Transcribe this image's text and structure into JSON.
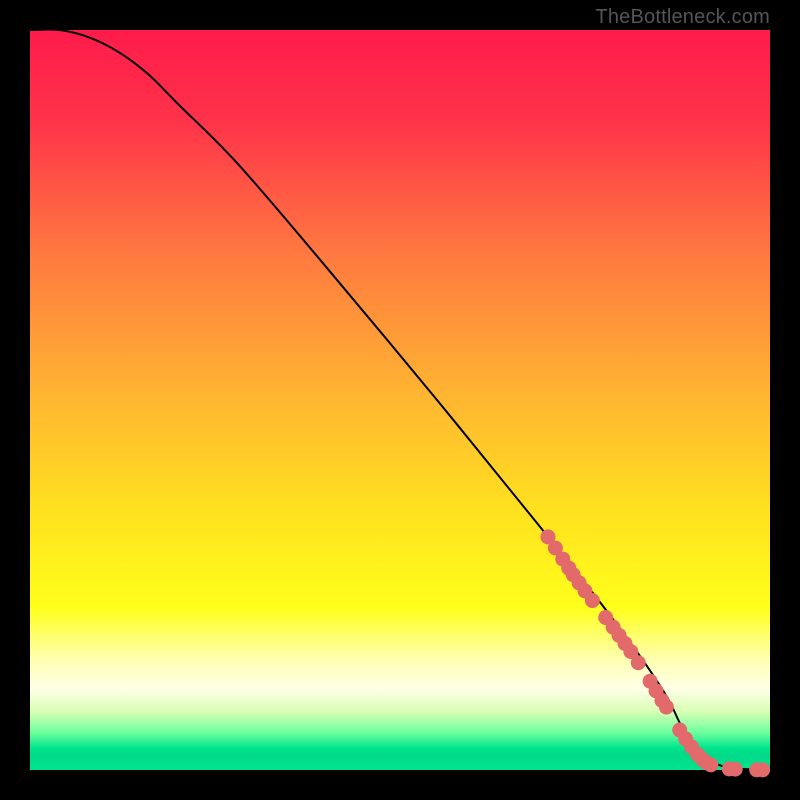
{
  "attribution": "TheBottleneck.com",
  "colors": {
    "frame": "#000000",
    "line": "#000000",
    "point_fill": "#e26a6a",
    "point_stroke": "#d85a5a",
    "attribution_text": "#555559"
  },
  "gradient_stops": [
    {
      "pct": 0,
      "color": "#ff1b4b"
    },
    {
      "pct": 12,
      "color": "#ff324a"
    },
    {
      "pct": 30,
      "color": "#ff7840"
    },
    {
      "pct": 50,
      "color": "#ffb731"
    },
    {
      "pct": 65,
      "color": "#ffe11f"
    },
    {
      "pct": 78,
      "color": "#ffff1b"
    },
    {
      "pct": 85,
      "color": "#ffffb0"
    },
    {
      "pct": 89,
      "color": "#ffffe8"
    },
    {
      "pct": 92,
      "color": "#d9ffb5"
    },
    {
      "pct": 95,
      "color": "#6bff9e"
    },
    {
      "pct": 97,
      "color": "#00e58e"
    },
    {
      "pct": 98,
      "color": "#00d989"
    },
    {
      "pct": 100,
      "color": "#00e58e"
    }
  ],
  "chart_data": {
    "type": "line",
    "title": "",
    "xlabel": "",
    "ylabel": "",
    "xlim": [
      0,
      100
    ],
    "ylim": [
      0,
      100
    ],
    "series": [
      {
        "name": "curve",
        "x": [
          0,
          4,
          8,
          12,
          16,
          20,
          28,
          40,
          55,
          68,
          76,
          82,
          86,
          88,
          90,
          92,
          94,
          96,
          98,
          100
        ],
        "y": [
          100,
          100,
          99,
          97,
          94,
          90,
          82,
          68,
          50,
          34,
          24,
          16,
          10,
          6,
          3,
          1.2,
          0.4,
          0.15,
          0.05,
          0
        ]
      }
    ],
    "points": [
      {
        "x": 70.0,
        "y": 31.5
      },
      {
        "x": 71.0,
        "y": 30.0
      },
      {
        "x": 72.0,
        "y": 28.5
      },
      {
        "x": 72.8,
        "y": 27.3
      },
      {
        "x": 73.4,
        "y": 26.4
      },
      {
        "x": 74.2,
        "y": 25.3
      },
      {
        "x": 75.0,
        "y": 24.2
      },
      {
        "x": 76.0,
        "y": 22.9
      },
      {
        "x": 77.8,
        "y": 20.6
      },
      {
        "x": 78.8,
        "y": 19.3
      },
      {
        "x": 79.6,
        "y": 18.2
      },
      {
        "x": 80.4,
        "y": 17.1
      },
      {
        "x": 81.2,
        "y": 16.0
      },
      {
        "x": 82.2,
        "y": 14.5
      },
      {
        "x": 83.8,
        "y": 12.0
      },
      {
        "x": 84.6,
        "y": 10.7
      },
      {
        "x": 85.4,
        "y": 9.4
      },
      {
        "x": 86.0,
        "y": 8.5
      },
      {
        "x": 87.8,
        "y": 5.4
      },
      {
        "x": 88.6,
        "y": 4.2
      },
      {
        "x": 89.4,
        "y": 3.1
      },
      {
        "x": 90.2,
        "y": 2.1
      },
      {
        "x": 90.8,
        "y": 1.5
      },
      {
        "x": 91.4,
        "y": 1.0
      },
      {
        "x": 92.0,
        "y": 0.7
      },
      {
        "x": 94.5,
        "y": 0.15
      },
      {
        "x": 95.3,
        "y": 0.12
      },
      {
        "x": 98.2,
        "y": 0.03
      },
      {
        "x": 99.0,
        "y": 0.02
      }
    ]
  }
}
